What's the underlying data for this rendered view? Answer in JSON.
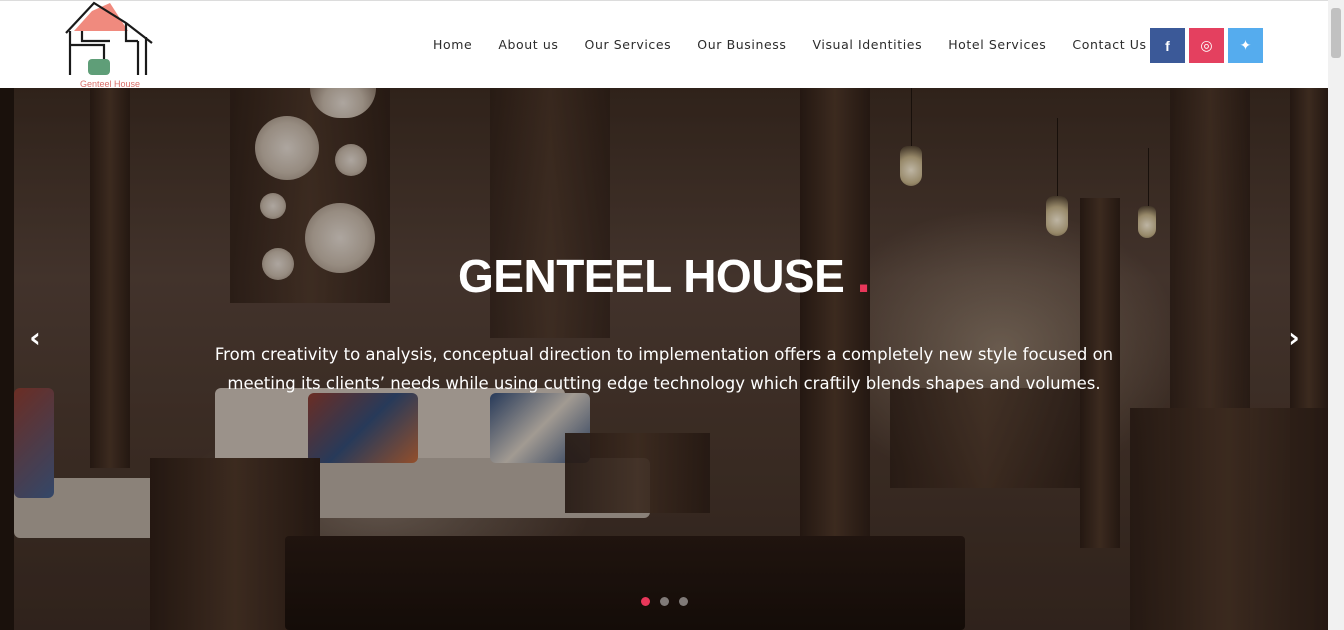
{
  "brand": {
    "name": "Genteel House"
  },
  "nav": {
    "items": [
      {
        "label": "Home"
      },
      {
        "label": "About us"
      },
      {
        "label": "Our Services"
      },
      {
        "label": "Our Business"
      },
      {
        "label": "Visual Identities"
      },
      {
        "label": "Hotel Services"
      },
      {
        "label": "Contact Us"
      }
    ]
  },
  "social": [
    {
      "name": "facebook-icon",
      "glyph": "f",
      "color": "#3b5998"
    },
    {
      "name": "instagram-icon",
      "glyph": "◎",
      "color": "#e4405f"
    },
    {
      "name": "twitter-icon",
      "glyph": "✦",
      "color": "#55acee"
    }
  ],
  "hero": {
    "title": "GENTEEL HOUSE",
    "title_dot": ".",
    "text": "From creativity to analysis, conceptual direction to implementation offers a completely new style focused on meeting its clients’ needs while using cutting edge technology which craftily blends shapes and volumes.",
    "prev_icon": "chevron-left-icon",
    "next_icon": "chevron-right-icon",
    "prev_glyph": "‹",
    "next_glyph": "›",
    "slides": 3,
    "active_slide": 1
  },
  "colors": {
    "accent": "#e8375a",
    "logo_roof": "#f08a7e",
    "logo_door": "#5f9e78"
  }
}
